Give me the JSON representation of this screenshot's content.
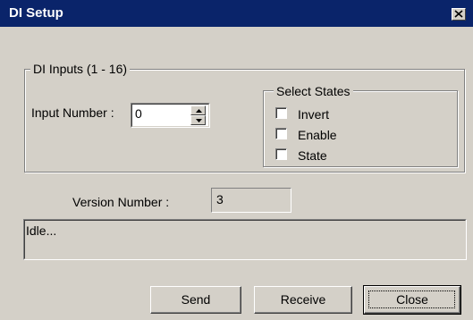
{
  "window": {
    "title": "DI Setup"
  },
  "inputs_group": {
    "legend": "DI Inputs (1 - 16)",
    "input_number_label": "Input Number :",
    "input_number_value": "0"
  },
  "states_group": {
    "legend": "Select States",
    "checkboxes": [
      {
        "label": "Invert",
        "checked": false
      },
      {
        "label": "Enable",
        "checked": false
      },
      {
        "label": "State",
        "checked": false
      }
    ]
  },
  "version": {
    "label": "Version Number :",
    "value": "3"
  },
  "status": {
    "text": "Idle..."
  },
  "buttons": {
    "send": "Send",
    "receive": "Receive",
    "close": "Close"
  },
  "icons": {
    "close": "close-icon",
    "spin_up": "arrow-up-icon",
    "spin_down": "arrow-down-icon"
  }
}
